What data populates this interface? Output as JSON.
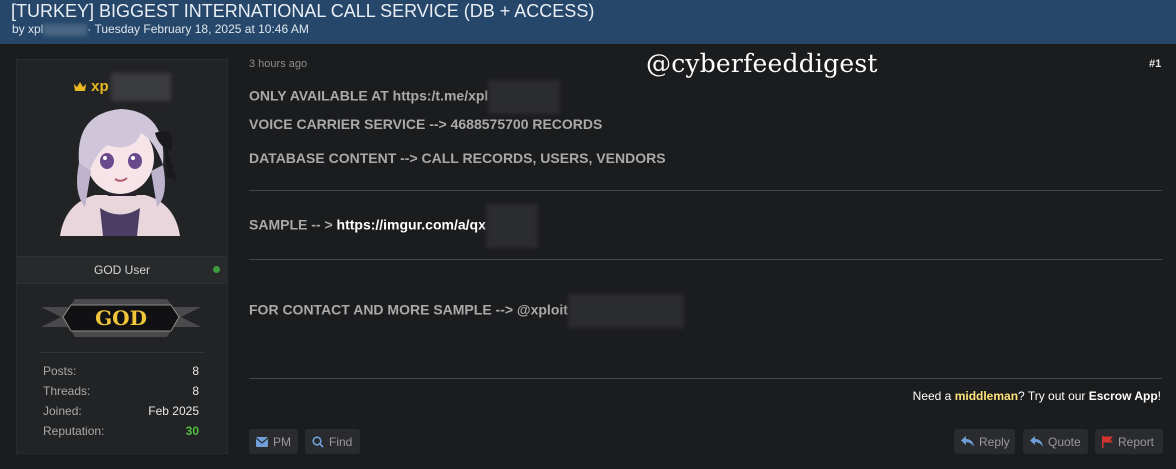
{
  "header": {
    "title": "[TURKEY] BIGGEST INTERNATIONAL CALL SERVICE (DB + ACCESS)",
    "by": "by xpl",
    "date": "· Tuesday February 18, 2025 at 10:46 AM"
  },
  "user": {
    "name": "xp",
    "rank": "GOD User",
    "badge_text": "GOD",
    "stats": [
      {
        "label": "Posts:",
        "value": "8"
      },
      {
        "label": "Threads:",
        "value": "8"
      },
      {
        "label": "Joined:",
        "value": "Feb 2025"
      },
      {
        "label": "Reputation:",
        "value": "30"
      }
    ]
  },
  "post": {
    "time": "3 hours ago",
    "number": "#1",
    "watermark": "@cyberfeeddigest",
    "line1": "ONLY AVAILABLE AT https:/t.me/xpl",
    "line2": "VOICE CARRIER SERVICE -->  4688575700 RECORDS",
    "line3": "DATABASE CONTENT --> CALL RECORDS, USERS, VENDORS",
    "sample_prefix": "SAMPLE -- > ",
    "sample_link": "https://imgur.com/a/qx",
    "contact": "FOR CONTACT AND MORE SAMPLE --> @xploit"
  },
  "escrow": {
    "pre": "Need a ",
    "middleman": "middleman",
    "mid": "? Try out our ",
    "app": "Escrow App",
    "end": "!"
  },
  "actions": {
    "pm": "PM",
    "find": "Find",
    "reply": "Reply",
    "quote": "Quote",
    "report": "Report"
  },
  "colors": {
    "header_bg": "#26476a",
    "username": "#e9b923",
    "reputation": "#4fbf3f",
    "online": "#3c9a3f",
    "report_flag": "#d0342c"
  }
}
